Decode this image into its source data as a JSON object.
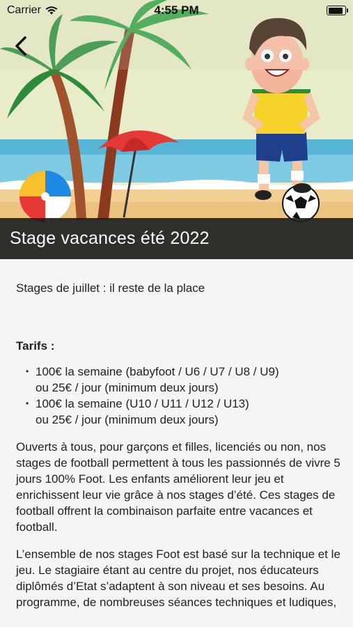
{
  "status_bar": {
    "carrier": "Carrier",
    "time": "4:55 PM"
  },
  "header": {
    "title": "Stage vacances été 2022"
  },
  "content": {
    "intro": "Stages de juillet : il reste de la place",
    "tarifs_heading": "Tarifs :",
    "tarifs": [
      {
        "line1": "100€ la semaine (babyfoot / U6 / U7 / U8 / U9)",
        "line2": "ou 25€ / jour (minimum deux jours)"
      },
      {
        "line1": "100€ la semaine (U10 / U11 / U12 / U13)",
        "line2": "ou 25€ / jour (minimum deux jours)"
      }
    ],
    "paragraphs": [
      "Ouverts à tous, pour garçons et filles, licenciés ou non, nos stages de football permettent à tous les passionnés de vivre 5 jours 100% Foot. Les enfants améliorent leur jeu et enrichissent leur vie grâce à nos stages d’été. Ces stages de football offrent la combinaison parfaite entre vacances et football.",
      "L’ensemble de nos stages Foot est basé sur la technique et le jeu. Le stagiaire étant au centre du projet, nos éducateurs diplômés d’Etat s’adaptent à son niveau et ses besoins. Au programme, de nombreuses séances techniques et ludiques,"
    ]
  }
}
